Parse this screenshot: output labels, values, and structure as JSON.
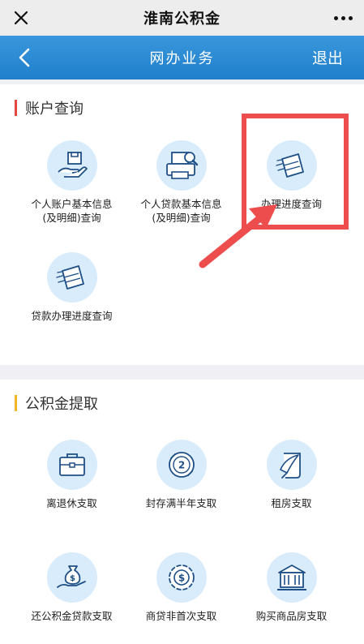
{
  "topbar": {
    "title": "淮南公积金",
    "close_icon": "close-icon",
    "more_icon": "more-icon"
  },
  "navbar": {
    "title": "网办业务",
    "exit_label": "退出",
    "back_icon": "chevron-left-icon"
  },
  "colors": {
    "accent_blue": "#2388d3",
    "highlight_red": "#ee4d4d",
    "icon_bg": "#d9ecfb",
    "section1_bar": "#e5463f",
    "section2_bar": "#f5b52a"
  },
  "account_section": {
    "title": "账户查询",
    "items": [
      {
        "line1": "个人账户基本信息",
        "line2": "(及明细)查询",
        "icon": "hand-box-icon"
      },
      {
        "line1": "个人贷款基本信息",
        "line2": "(及明细)查询",
        "icon": "printer-search-icon"
      },
      {
        "line1": "办理进度查询",
        "line2": "",
        "icon": "paper-plane-icon"
      },
      {
        "line1": "贷款办理进度查询",
        "line2": "",
        "icon": "paper-plane-icon"
      }
    ]
  },
  "withdraw_section": {
    "title": "公积金提取",
    "items": [
      {
        "line1": "离退休支取",
        "icon": "briefcase-icon"
      },
      {
        "line1": "封存满半年支取",
        "icon": "cycle-2-icon"
      },
      {
        "line1": "租房支取",
        "icon": "quill-scroll-icon"
      },
      {
        "line1": "还公积金贷款支取",
        "icon": "money-bag-hand-icon"
      },
      {
        "line1": "商贷非首次支取",
        "icon": "coin-dollar-icon"
      },
      {
        "line1": "购买商品房支取",
        "icon": "building-icon"
      }
    ]
  }
}
